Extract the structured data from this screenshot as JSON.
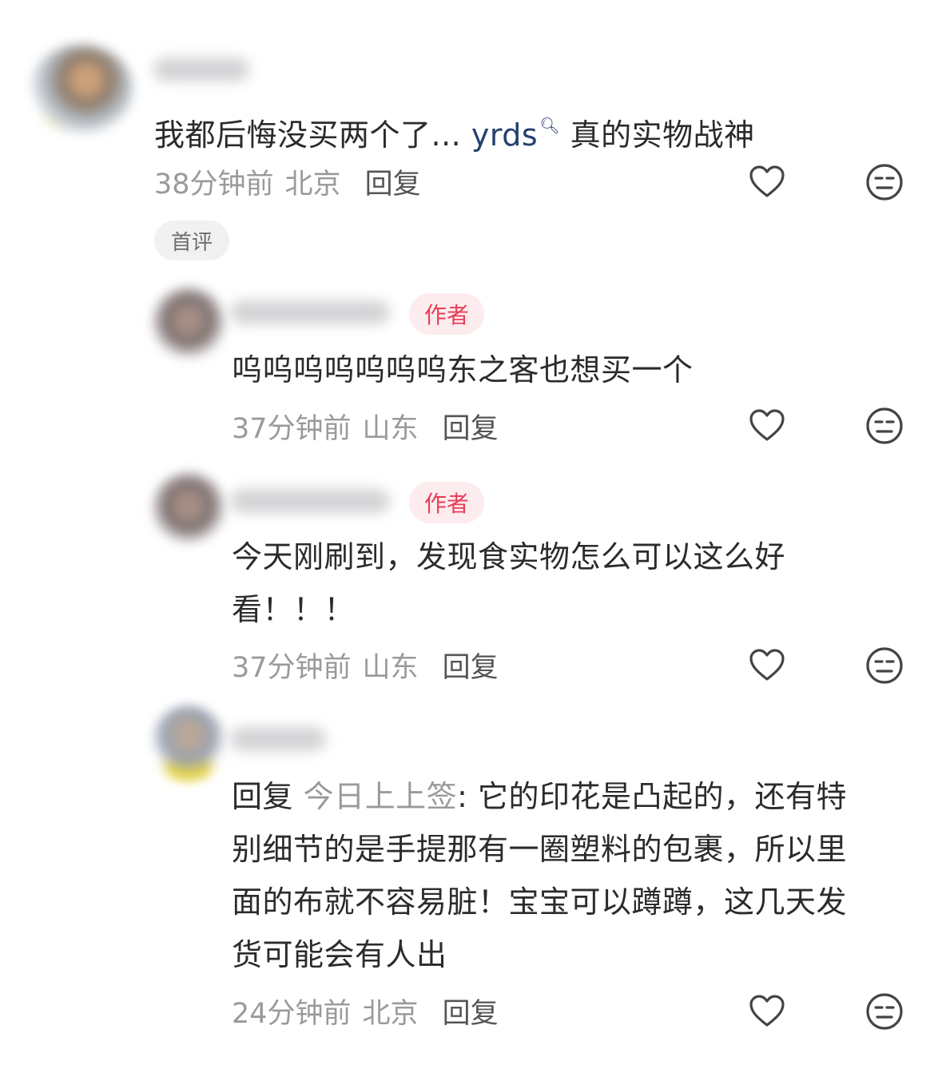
{
  "comments": [
    {
      "text_before": "我都后悔没买两个了... ",
      "highlight": "yrds",
      "text_after": " 真的实物战神",
      "time": "38分钟前",
      "location": "北京",
      "reply_label": "回复",
      "tag": "首评",
      "like_icon": "heart-icon",
      "dislike_icon": "meh-face-icon"
    },
    {
      "badge": "作者",
      "text": "呜呜呜呜呜呜呜东之客也想买一个",
      "time": "37分钟前",
      "location": "山东",
      "reply_label": "回复",
      "like_icon": "heart-icon",
      "dislike_icon": "meh-face-icon"
    },
    {
      "badge": "作者",
      "text_line1": "今天刚刷到，发现食实物怎么可以这么好",
      "text_line2": "看！！！",
      "time": "37分钟前",
      "location": "山东",
      "reply_label": "回复",
      "like_icon": "heart-icon",
      "dislike_icon": "meh-face-icon"
    },
    {
      "reply_prefix": "回复",
      "reply_target": "今日上上签",
      "line1": ": 它的印花是凸起的，还有特",
      "line2": "别细节的是手提那有一圈塑料的包裹，所以里",
      "line3": "面的布就不容易脏！宝宝可以蹲蹲，这几天发",
      "line4": "货可能会有人出",
      "time": "24分钟前",
      "location": "北京",
      "reply_label": "回复",
      "like_icon": "heart-icon",
      "dislike_icon": "meh-face-icon"
    }
  ]
}
